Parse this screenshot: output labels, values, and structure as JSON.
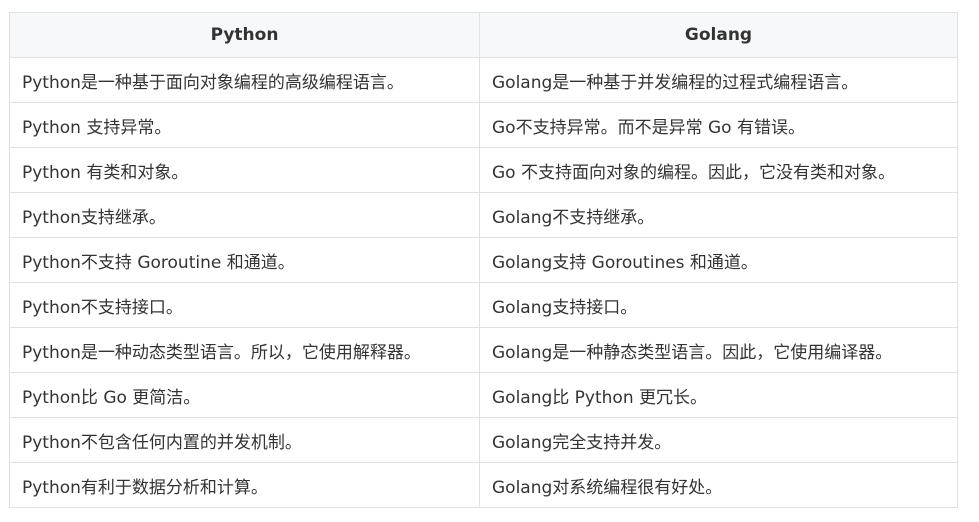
{
  "table": {
    "headers": [
      "Python",
      "Golang"
    ],
    "rows": [
      [
        "Python是一种基于面向对象编程的高级编程语言。",
        "Golang是一种基于并发编程的过程式编程语言。"
      ],
      [
        "Python 支持异常。",
        "Go不支持异常。而不是异常 Go 有错误。"
      ],
      [
        "Python 有类和对象。",
        "Go 不支持面向对象的编程。因此，它没有类和对象。"
      ],
      [
        "Python支持继承。",
        "Golang不支持继承。"
      ],
      [
        "Python不支持 Goroutine 和通道。",
        "Golang支持 Goroutines 和通道。"
      ],
      [
        "Python不支持接口。",
        "Golang支持接口。"
      ],
      [
        "Python是一种动态类型语言。所以，它使用解释器。",
        "Golang是一种静态类型语言。因此，它使用编译器。"
      ],
      [
        "Python比 Go 更简洁。",
        "Golang比 Python 更冗长。"
      ],
      [
        "Python不包含任何内置的并发机制。",
        "Golang完全支持并发。"
      ],
      [
        "Python有利于数据分析和计算。",
        "Golang对系统编程很有好处。"
      ]
    ]
  }
}
